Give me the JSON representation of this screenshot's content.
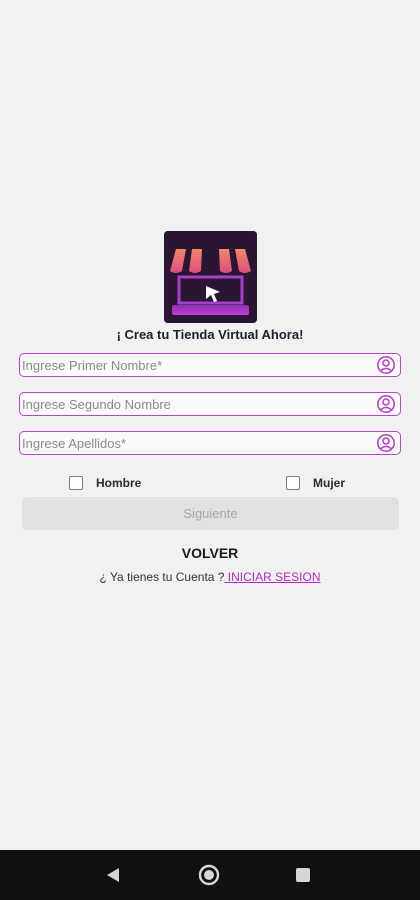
{
  "tagline": "¡ Crea tu Tienda Virtual Ahora!",
  "fields": {
    "first_name": {
      "placeholder": "Ingrese Primer Nombre*",
      "value": ""
    },
    "second_name": {
      "placeholder": "Ingrese Segundo Nombre",
      "value": ""
    },
    "last_names": {
      "placeholder": "Ingrese Apellidos*",
      "value": ""
    }
  },
  "gender": {
    "male_label": "Hombre",
    "female_label": "Mujer"
  },
  "next_label": "Siguiente",
  "back_label": "VOLVER",
  "account": {
    "question": "¿ Ya tienes tu Cuenta  ?",
    "login_link": " INICIAR SESION"
  },
  "icons": {
    "logo": "storefront-cursor-logo",
    "field": "user-circle-icon",
    "nav": [
      "back-triangle-icon",
      "home-circle-icon",
      "recents-square-icon"
    ]
  },
  "colors": {
    "accent": "#b548c6",
    "link": "#b02cc0",
    "logo_bg": "#2a1532",
    "awning": "#f07a62"
  }
}
